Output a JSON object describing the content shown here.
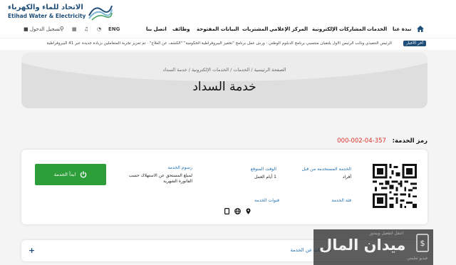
{
  "brand": {
    "name_ar": "الاتحاد للماء والكهرباء",
    "name_en": "Etihad Water & Electricity"
  },
  "nav": {
    "home_icon": "home-icon",
    "items": [
      "نبذة عنا",
      "الخدمات",
      "المشاركات الإلكترونية",
      "المركز الإعلامي",
      "المشتريات",
      "البيانات المفتوحة",
      "وظائف",
      "اتصل بنا"
    ],
    "lang": "ENG",
    "login": "تسجيل الدخول"
  },
  "ticker": {
    "badge": "آخر الأخبار",
    "text": "الرئيس التنفيذي ونائب الرئيس الأول يلتقيان منتسبي برنامج الدبلوم الوطني  ·  ورش عمل برنامج \"تحفيز البيروقراطية الحكومية\" \"الكشف عن العلاج\"  ·  تم تعزيز تجربة المتعاملين بزيادة جديدة عبر 41 البيروقراطية"
  },
  "hero": {
    "breadcrumb": "الصفحة الرئيسية / الخدمات / الخدمات الإلكترونية / خدمة السداد",
    "title": "خدمة السداد"
  },
  "service": {
    "code_label": "رمز الخدمة:",
    "code_value": "357-04-002-000",
    "users_label": "الخدمة المستخدمة من قبل",
    "users_value": "أفراد",
    "time_label": "الوقت المتوقع",
    "time_value": "1 أيام العمل",
    "fees_label": "رسوم الخدمة",
    "fees_value": "لمبلغ المستحق عن الاستهلاك حسب الفاتورة الشهرية",
    "category_label": "فئة الخدمة",
    "channels_label": "قنوات الخدمة",
    "start_button": "ابدأ الخدمة"
  },
  "accordion": {
    "title": "معلومات عن الخدمة"
  },
  "watermark": {
    "sub": "انتقل لتفعيل ويندوز",
    "main": "ميدان المال",
    "tag": "فيديو تعليمي"
  },
  "colors": {
    "brand_blue": "#1f4e79",
    "link_blue": "#1f6fb0",
    "green": "#2e9e3a",
    "red": "#d9312b"
  }
}
